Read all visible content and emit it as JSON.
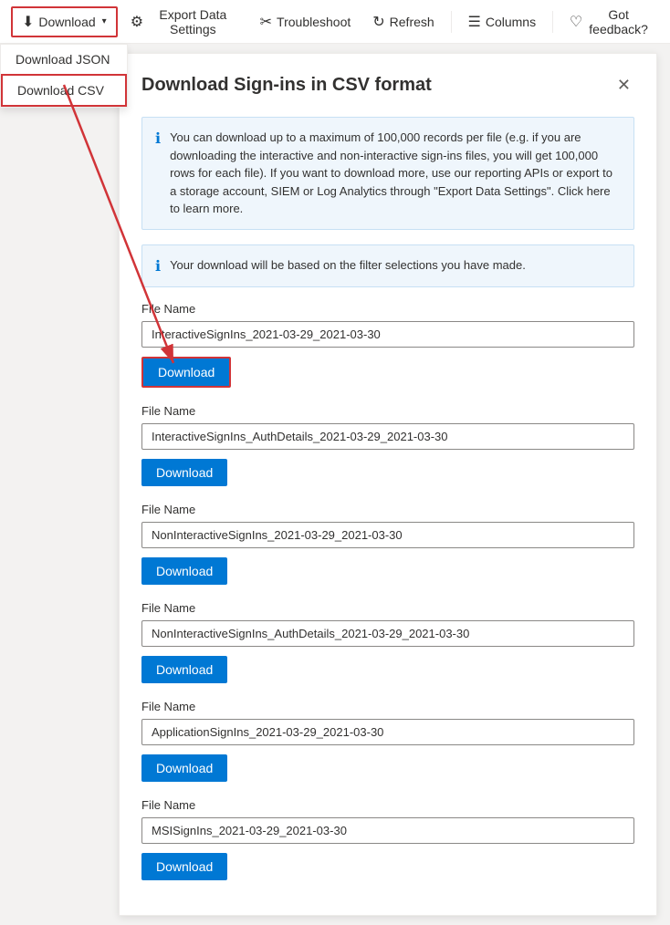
{
  "toolbar": {
    "download_label": "Download",
    "chevron": "▾",
    "export_label": "Export Data Settings",
    "troubleshoot_label": "Troubleshoot",
    "refresh_label": "Refresh",
    "columns_label": "Columns",
    "feedback_label": "Got feedback?"
  },
  "dropdown": {
    "json_label": "Download JSON",
    "csv_label": "Download CSV"
  },
  "modal": {
    "title": "Download Sign-ins in CSV format",
    "close_icon": "✕",
    "info1": "You can download up to a maximum of 100,000 records per file (e.g. if you are downloading the interactive and non-interactive sign-ins files, you will get 100,000 rows for each file). If you want to download more, use our reporting APIs or export to a storage account, SIEM or Log Analytics through \"Export Data Settings\". Click here to learn more.",
    "info2": "Your download will be based on the filter selections you have made.",
    "files": [
      {
        "label": "File Name",
        "value": "InteractiveSignIns_2021-03-29_2021-03-30",
        "btn_label": "Download",
        "highlighted": true
      },
      {
        "label": "File Name",
        "value": "InteractiveSignIns_AuthDetails_2021-03-29_2021-03-30",
        "btn_label": "Download",
        "highlighted": false
      },
      {
        "label": "File Name",
        "value": "NonInteractiveSignIns_2021-03-29_2021-03-30",
        "btn_label": "Download",
        "highlighted": false
      },
      {
        "label": "File Name",
        "value": "NonInteractiveSignIns_AuthDetails_2021-03-29_2021-03-30",
        "btn_label": "Download",
        "highlighted": false
      },
      {
        "label": "File Name",
        "value": "ApplicationSignIns_2021-03-29_2021-03-30",
        "btn_label": "Download",
        "highlighted": false
      },
      {
        "label": "File Name",
        "value": "MSISignIns_2021-03-29_2021-03-30",
        "btn_label": "Download",
        "highlighted": false
      }
    ]
  }
}
